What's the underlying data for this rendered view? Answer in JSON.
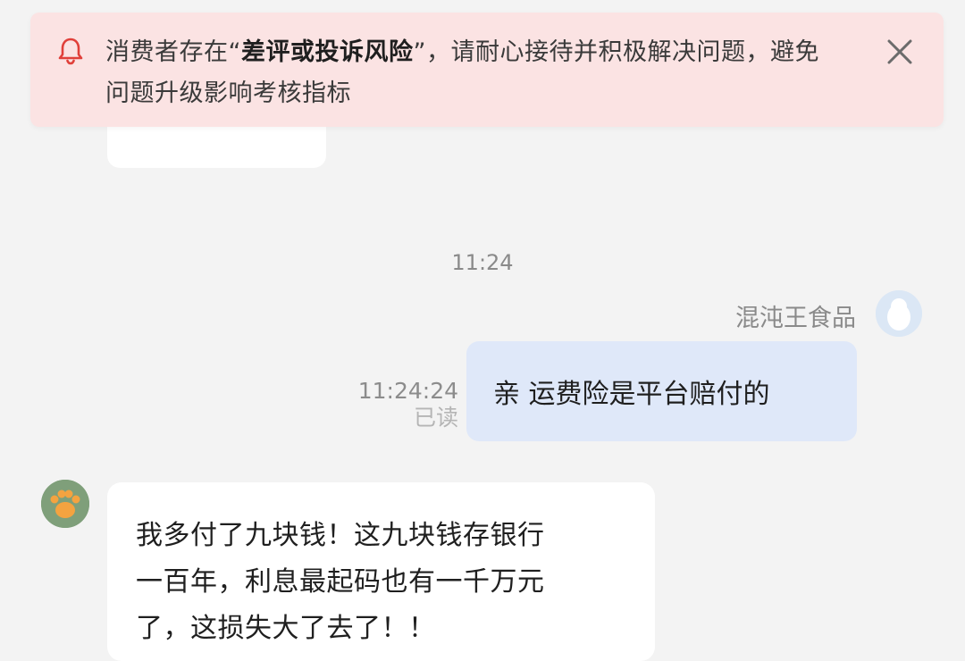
{
  "banner": {
    "text_prefix": "消费者存在“",
    "text_emphasis": "差评或投诉风险",
    "text_suffix": "”，请耐心接待并积极解决问题，避免问题升级影响考核指标",
    "icon": "bell-icon",
    "close_icon": "close-icon",
    "background_color": "#fbe3e3",
    "bell_color": "#e0403a"
  },
  "time_divider": "11:24",
  "outgoing": {
    "sender_name": "混沌王食品",
    "message": "亲 运费险是平台赔付的",
    "time": "11:24:24",
    "status": "已读",
    "bubble_color": "#dfe8f9"
  },
  "incoming": {
    "lines": [
      "我多付了九块钱！这九块钱存银行",
      "一百年，利息最起码也有一千万元",
      "了，这损失大了去了！！"
    ],
    "bubble_color": "#ffffff"
  }
}
